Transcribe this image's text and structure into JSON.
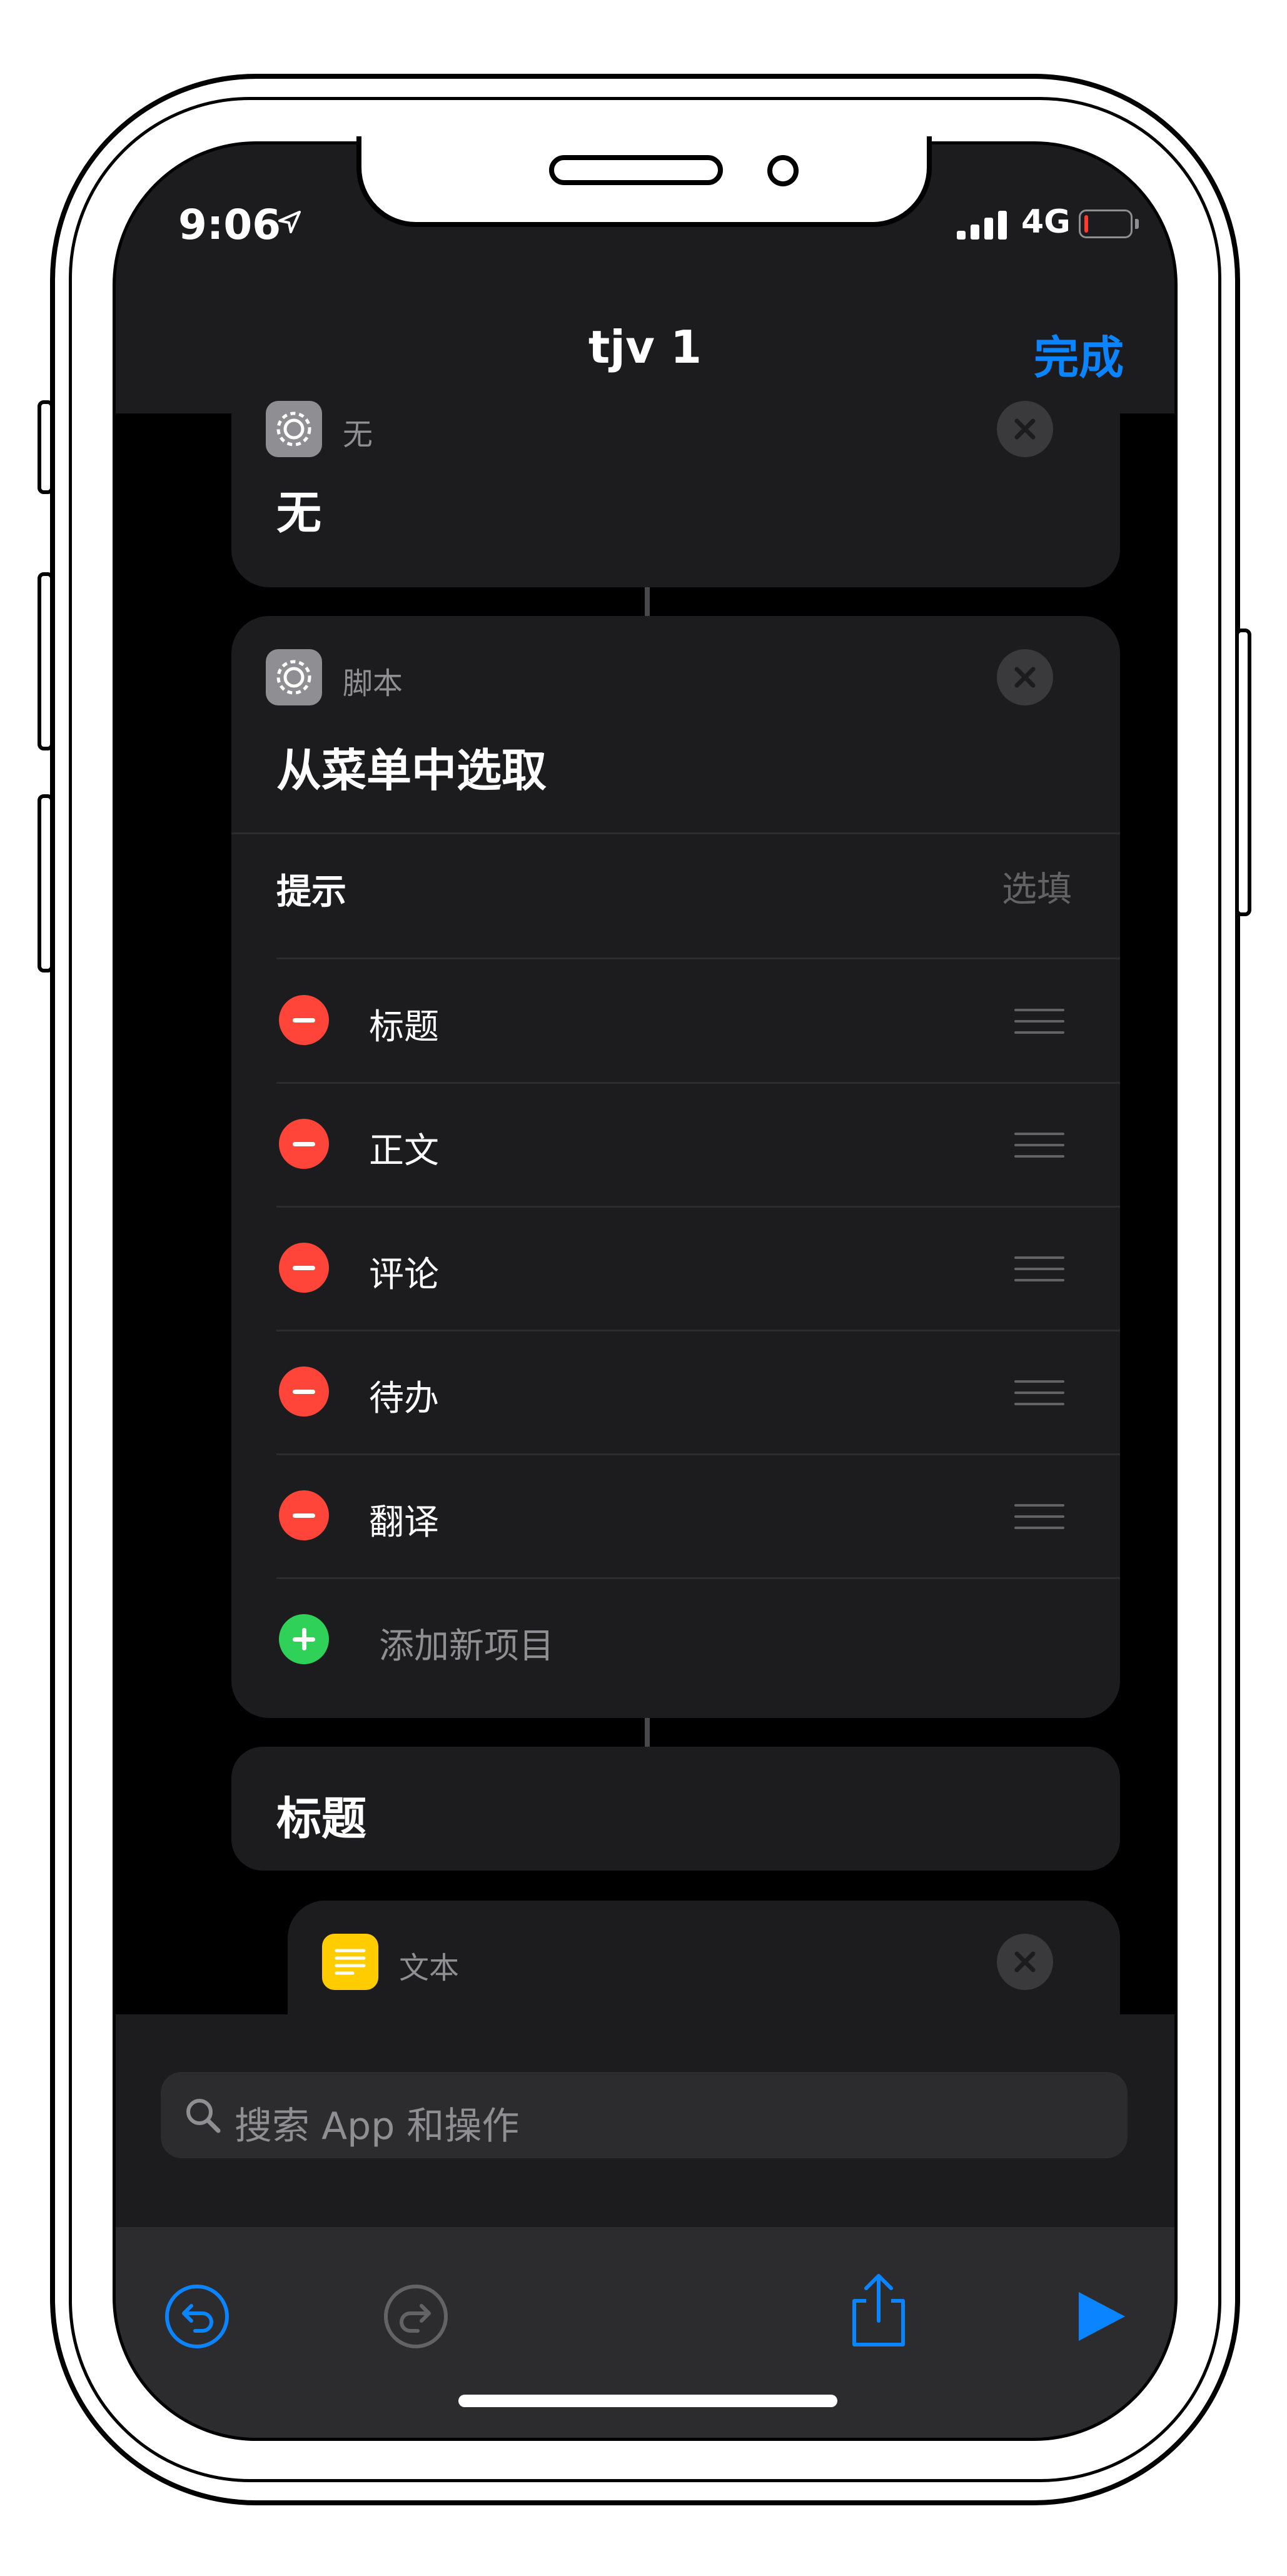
{
  "status_bar": {
    "time": "9:06",
    "network": "4G",
    "location_icon": "location-arrow-icon",
    "signal_icon": "signal-bars-icon",
    "battery_icon": "battery-low-icon"
  },
  "nav": {
    "title": "tjv 1",
    "done_label": "完成"
  },
  "cards": {
    "none_action": {
      "category": "无",
      "title": "无"
    },
    "menu_action": {
      "category": "脚本",
      "title": "从菜单中选取",
      "prompt_label": "提示",
      "prompt_placeholder": "选填",
      "items": [
        "标题",
        "正文",
        "评论",
        "待办",
        "翻译"
      ],
      "add_label": "添加新项目"
    },
    "menu_case": {
      "title": "标题"
    },
    "text_action": {
      "category": "文本"
    }
  },
  "search": {
    "placeholder": "搜索 App 和操作"
  },
  "toolbar": {
    "icons": [
      "undo-icon",
      "redo-icon",
      "share-icon",
      "play-icon"
    ]
  },
  "colors": {
    "accent": "#0a84ff",
    "destructive": "#ff453a",
    "add": "#30d158",
    "card": "#1c1c1e",
    "text_action": "#ffcc00"
  }
}
